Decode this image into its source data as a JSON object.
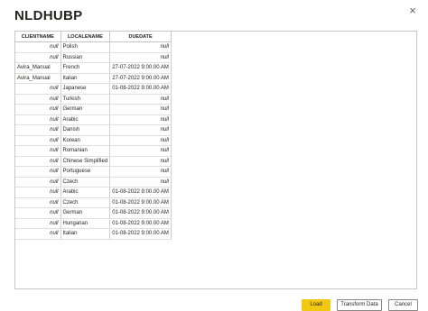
{
  "window": {
    "close_glyph": "×"
  },
  "title": "NLDHUBP",
  "table": {
    "headers": [
      "CLIENTNAME",
      "LOCALENAME",
      "DUEDATE"
    ],
    "rows": [
      [
        "null",
        "Polish",
        "null"
      ],
      [
        "null",
        "Russian",
        "null"
      ],
      [
        "Avira_Manual",
        "French",
        "27-07-2022 9:00.00 AM"
      ],
      [
        "Avira_Manual",
        "Italian",
        "27-07-2022 9:00.00 AM"
      ],
      [
        "null",
        "Japanese",
        "01-08-2022 9:00.00 AM"
      ],
      [
        "null",
        "Turkish",
        "null"
      ],
      [
        "null",
        "German",
        "null"
      ],
      [
        "null",
        "Arabic",
        "null"
      ],
      [
        "null",
        "Danish",
        "null"
      ],
      [
        "null",
        "Korean",
        "null"
      ],
      [
        "null",
        "Romanian",
        "null"
      ],
      [
        "null",
        "Chinese Simplified",
        "null"
      ],
      [
        "null",
        "Portuguese",
        "null"
      ],
      [
        "null",
        "Czech",
        "null"
      ],
      [
        "null",
        "Arabic",
        "01-08-2022 9:00.00 AM"
      ],
      [
        "null",
        "Czech",
        "01-08-2022 9:00.00 AM"
      ],
      [
        "null",
        "German",
        "01-08-2022 9:00.00 AM"
      ],
      [
        "null",
        "Hungarian",
        "01-08-2022 9:00.00 AM"
      ],
      [
        "null",
        "Italian",
        "01-08-2022 9:00.00 AM"
      ]
    ]
  },
  "buttons": {
    "load": "Load",
    "transform": "Transform Data",
    "cancel": "Cancel"
  },
  "colors": {
    "load_accent": "#f2c811",
    "border": "#c8c6c4"
  },
  "icons": {
    "close": "close-icon"
  }
}
